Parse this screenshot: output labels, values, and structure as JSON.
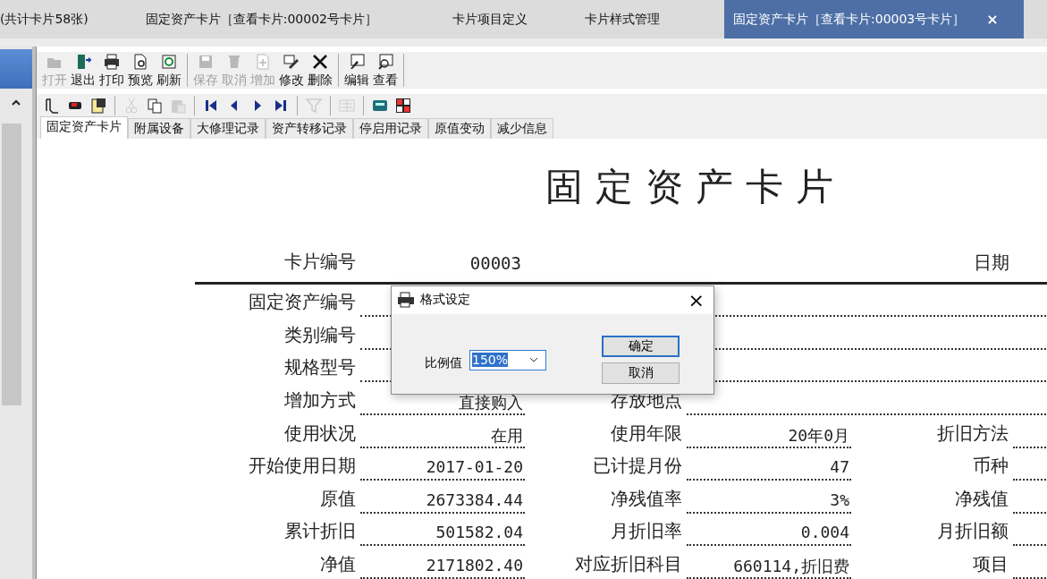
{
  "doc_tabs": [
    {
      "label": "(共计卡片58张)",
      "selected": false
    },
    {
      "label": "固定资产卡片［查看卡片:00002号卡片］",
      "selected": false
    },
    {
      "label": "卡片项目定义",
      "selected": false
    },
    {
      "label": "卡片样式管理",
      "selected": false
    },
    {
      "label": "固定资产卡片［查看卡片:00003号卡片］",
      "selected": true,
      "close": "×"
    }
  ],
  "toolbar": [
    [
      {
        "label": "打开",
        "disabled": true
      },
      {
        "label": "退出",
        "disabled": false
      },
      {
        "label": "打印",
        "disabled": false
      },
      {
        "label": "预览",
        "disabled": false
      },
      {
        "label": "刷新",
        "disabled": false
      }
    ],
    [
      {
        "label": "保存",
        "disabled": true
      },
      {
        "label": "取消",
        "disabled": true
      },
      {
        "label": "增加",
        "disabled": true
      },
      {
        "label": "修改",
        "disabled": false
      },
      {
        "label": "删除",
        "disabled": false
      }
    ],
    [
      {
        "label": "编辑",
        "disabled": false
      },
      {
        "label": "查看",
        "disabled": false
      }
    ]
  ],
  "icon_bar": [
    [
      {
        "disabled": false
      },
      {
        "disabled": false
      },
      {
        "disabled": false
      }
    ],
    [
      {
        "disabled": true
      },
      {
        "disabled": false
      },
      {
        "disabled": true
      }
    ],
    [
      {
        "disabled": false
      },
      {
        "disabled": false
      },
      {
        "disabled": false
      },
      {
        "disabled": false
      }
    ],
    [
      {
        "disabled": true
      }
    ],
    [
      {
        "disabled": true
      }
    ],
    [
      {
        "disabled": false
      },
      {
        "disabled": false
      }
    ]
  ],
  "card_tabs": [
    {
      "label": "固定资产卡片",
      "selected": true
    },
    {
      "label": "附属设备",
      "selected": false
    },
    {
      "label": "大修理记录",
      "selected": false
    },
    {
      "label": "资产转移记录",
      "selected": false
    },
    {
      "label": "停启用记录",
      "selected": false
    },
    {
      "label": "原值变动",
      "selected": false
    },
    {
      "label": "减少信息",
      "selected": false
    }
  ],
  "card": {
    "title": "固定资产卡片",
    "number_label": "卡片编号",
    "number": "00003",
    "date_label": "日期",
    "rows": [
      [
        {
          "label": "固定资产编号"
        }
      ],
      [
        {
          "label": "类别编号"
        }
      ],
      [
        {
          "label": "规格型号"
        }
      ],
      [
        {
          "label": "增加方式",
          "value": "直接购入"
        },
        {
          "label": "存放地点"
        }
      ],
      [
        {
          "label": "使用状况",
          "value": "在用"
        },
        {
          "label": "使用年限",
          "value": "20年0月"
        },
        {
          "label": "折旧方法"
        }
      ],
      [
        {
          "label": "开始使用日期",
          "value": "2017-01-20"
        },
        {
          "label": "已计提月份",
          "value": "47"
        },
        {
          "label": "币种"
        }
      ],
      [
        {
          "label": "原值",
          "value": "2673384.44"
        },
        {
          "label": "净残值率",
          "value": "3%"
        },
        {
          "label": "净残值"
        }
      ],
      [
        {
          "label": "累计折旧",
          "value": "501582.04"
        },
        {
          "label": "月折旧率",
          "value": "0.004"
        },
        {
          "label": "月折旧额"
        }
      ],
      [
        {
          "label": "净值",
          "value": "2171802.40"
        },
        {
          "label": "对应折旧科目",
          "value": "660114,折旧费"
        },
        {
          "label": "项目"
        }
      ]
    ]
  },
  "dialog": {
    "title": "格式设定",
    "close": "×",
    "field_label": "比例值",
    "value": "150%",
    "buttons": [
      {
        "label": "确定",
        "default": true
      },
      {
        "label": "取消",
        "default": false
      }
    ]
  }
}
